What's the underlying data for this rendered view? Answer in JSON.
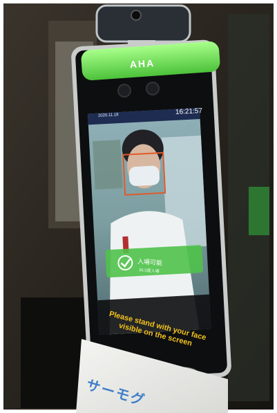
{
  "photo": {
    "subject": "face recognition temperature screening kiosk"
  },
  "kiosk": {
    "brand": "AHA",
    "screen": {
      "date": "2020.11.18 ",
      "time": "16:21:57",
      "pass_text": "入場可能",
      "pass_subtext": "36.5度入場",
      "instruction": "Please stand with your face visible on the screen"
    }
  },
  "sign": {
    "text": "サーモグ"
  },
  "colors": {
    "frame_green": "#7de35a",
    "pass_banner": "#4fc24a",
    "instruction_text": "#f2c21c",
    "sign_text": "#3f7ec9"
  }
}
